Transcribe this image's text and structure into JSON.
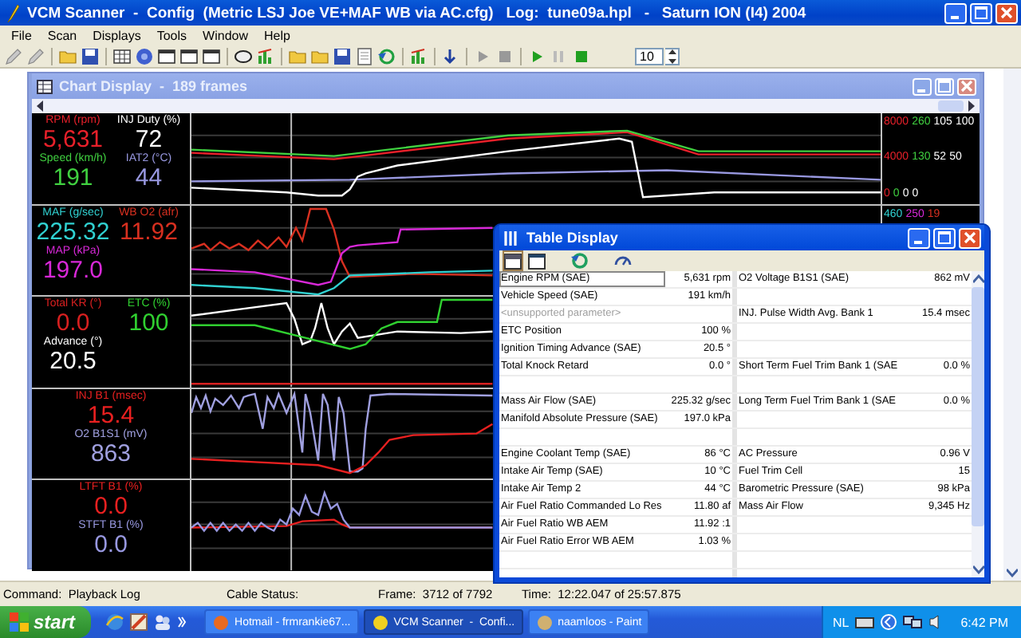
{
  "window": {
    "title": "VCM Scanner  -  Config  (Metric LSJ Joe VE+MAF WB via AC.cfg)   Log:  tune09a.hpl   -   Saturn ION (I4) 2004"
  },
  "menu": [
    "File",
    "Scan",
    "Displays",
    "Tools",
    "Window",
    "Help"
  ],
  "toolbar": {
    "interval": "10"
  },
  "chart_display": {
    "title": "Chart Display  -  189 frames",
    "panels": [
      {
        "columns": [
          [
            {
              "label": "RPM (rpm)",
              "value": "5,631",
              "color": "#e8202a"
            },
            {
              "label": "Speed (km/h)",
              "value": "191",
              "color": "#40d040"
            }
          ],
          [
            {
              "label": "INJ Duty (%)",
              "value": "72",
              "color": "#ffffff"
            },
            {
              "label": "IAT2 (°C)",
              "value": "44",
              "color": "#9898e0"
            }
          ]
        ],
        "scale_rows": [
          [
            {
              "text": "8000",
              "color": "#e8202a"
            },
            {
              "text": "260",
              "color": "#40d040"
            },
            {
              "text": "105",
              "color": "#ffffff"
            },
            {
              "text": "100",
              "color": "#ffffff"
            }
          ],
          [
            {
              "text": "4000",
              "color": "#e8202a"
            },
            {
              "text": "130",
              "color": "#40d040"
            },
            {
              "text": "52",
              "color": "#ffffff"
            },
            {
              "text": "50",
              "color": "#ffffff"
            }
          ],
          [
            {
              "text": "0",
              "color": "#e8202a"
            },
            {
              "text": "0",
              "color": "#40d040"
            },
            {
              "text": "0",
              "color": "#ffffff"
            },
            {
              "text": "0",
              "color": "#ffffff"
            }
          ]
        ]
      },
      {
        "columns": [
          [
            {
              "label": "MAF (g/sec)",
              "value": "225.32",
              "color": "#30d0d0"
            },
            {
              "label": "MAP (kPa)",
              "value": "197.0",
              "color": "#d828d8"
            }
          ],
          [
            {
              "label": "WB O2 (afr)",
              "value": "11.92",
              "color": "#d83020"
            }
          ]
        ],
        "scale_rows": [
          [
            {
              "text": "460",
              "color": "#30d0d0"
            },
            {
              "text": "250",
              "color": "#d828d8"
            },
            {
              "text": "19",
              "color": "#d83020"
            }
          ]
        ]
      },
      {
        "columns": [
          [
            {
              "label": "Total KR (°)",
              "value": "0.0",
              "color": "#d82020"
            },
            {
              "label": "Advance (°)",
              "value": "20.5",
              "color": "#ffffff"
            }
          ],
          [
            {
              "label": "ETC (%)",
              "value": "100",
              "color": "#30d030"
            }
          ]
        ]
      },
      {
        "columns": [
          [
            {
              "label": "INJ B1 (msec)",
              "value": "15.4",
              "color": "#e82020"
            },
            {
              "label": "O2 B1S1 (mV)",
              "value": "863",
              "color": "#a0a0e0"
            }
          ]
        ]
      },
      {
        "columns": [
          [
            {
              "label": "LTFT B1 (%)",
              "value": "0.0",
              "color": "#e82020"
            },
            {
              "label": "STFT B1 (%)",
              "value": "0.0",
              "color": "#9898e0"
            }
          ]
        ]
      }
    ]
  },
  "table_display": {
    "title": "Table Display",
    "rows": [
      {
        "kind": "data",
        "disabled": false,
        "name_1": "Engine RPM (SAE)",
        "value_1": "5,631 rpm",
        "name_2": "O2 Voltage B1S1 (SAE)",
        "value_2": "862 mV"
      },
      {
        "kind": "data",
        "disabled": false,
        "name_1": "Vehicle Speed (SAE)",
        "value_1": "191 km/h"
      },
      {
        "kind": "data",
        "disabled": true,
        "name_1": "<unsupported parameter>",
        "name_2": "INJ. Pulse Width Avg. Bank 1",
        "value_2": "15.4 msec"
      },
      {
        "kind": "data",
        "disabled": false,
        "name_1": "ETC Position",
        "value_1": "100 %"
      },
      {
        "kind": "data",
        "disabled": false,
        "name_1": "Ignition Timing Advance (SAE)",
        "value_1": "20.5 °"
      },
      {
        "kind": "data",
        "disabled": false,
        "name_1": "Total Knock Retard",
        "value_1": "0.0 °",
        "name_2": "Short Term Fuel Trim Bank 1 (SAE",
        "value_2": "0.0 %"
      },
      {
        "kind": "blank"
      },
      {
        "kind": "data",
        "disabled": false,
        "name_1": "Mass Air Flow (SAE)",
        "value_1": "225.32 g/sec",
        "name_2": "Long Term Fuel Trim Bank 1 (SAE",
        "value_2": "0.0 %"
      },
      {
        "kind": "data",
        "disabled": false,
        "name_1": "Manifold Absolute Pressure (SAE)",
        "value_1": "197.0 kPa"
      },
      {
        "kind": "blank"
      },
      {
        "kind": "data",
        "disabled": false,
        "name_1": "Engine Coolant Temp (SAE)",
        "value_1": "86 °C",
        "name_2": "AC Pressure",
        "value_2": "0.96 V"
      },
      {
        "kind": "data",
        "disabled": false,
        "name_1": "Intake Air Temp (SAE)",
        "value_1": "10 °C",
        "name_2": "Fuel Trim Cell",
        "value_2": "15"
      },
      {
        "kind": "data",
        "disabled": false,
        "name_1": "Intake Air Temp 2",
        "value_1": "44 °C",
        "name_2": "Barometric Pressure (SAE)",
        "value_2": "98 kPa"
      },
      {
        "kind": "data",
        "disabled": false,
        "name_1": "Air Fuel Ratio Commanded Lo Res",
        "value_1": "11.80 af",
        "name_2": "Mass Air Flow",
        "value_2": "9,345 Hz"
      },
      {
        "kind": "data",
        "disabled": false,
        "name_1": "Air Fuel Ratio WB AEM",
        "value_1": "11.92 :1"
      },
      {
        "kind": "data",
        "disabled": false,
        "name_1": "Air Fuel Ratio Error WB AEM",
        "value_1": "1.03 %"
      },
      {
        "kind": "blank"
      }
    ]
  },
  "status_bar": {
    "command": "Command:  Playback Log",
    "cable_status": "Cable Status:",
    "frame": "Frame:  3712 of 7792",
    "time": "Time:  12:22.047 of 25:57.875"
  },
  "taskbar": {
    "start": "start",
    "tasks": [
      {
        "label": "Hotmail - frmrankie67...",
        "selected": false
      },
      {
        "label": "VCM Scanner  -  Confi...",
        "selected": true
      },
      {
        "label": "naamloos - Paint",
        "selected": false
      }
    ],
    "language": "NL",
    "clock": "6:42 PM"
  }
}
